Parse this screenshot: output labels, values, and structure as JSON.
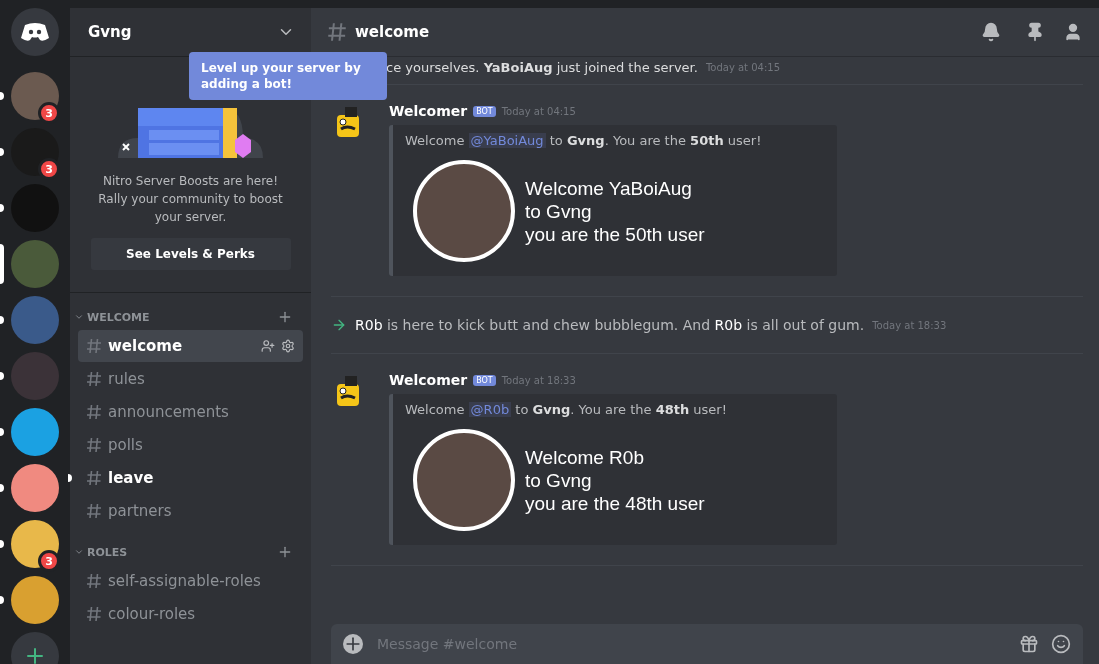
{
  "servers": [
    {
      "kind": "home",
      "selected": false,
      "unread": false
    },
    {
      "kind": "server",
      "selected": false,
      "unread": true,
      "badge": "3"
    },
    {
      "kind": "server",
      "selected": false,
      "unread": true,
      "badge": "3"
    },
    {
      "kind": "server",
      "selected": false,
      "unread": true
    },
    {
      "kind": "server",
      "selected": true
    },
    {
      "kind": "server",
      "selected": false,
      "unread": true
    },
    {
      "kind": "server",
      "selected": false,
      "unread": true
    },
    {
      "kind": "server",
      "selected": false,
      "unread": true
    },
    {
      "kind": "server",
      "selected": false,
      "unread": true
    },
    {
      "kind": "server",
      "selected": false,
      "unread": true,
      "badge": "3"
    },
    {
      "kind": "server",
      "selected": false,
      "unread": true
    },
    {
      "kind": "add",
      "selected": false,
      "unread": false
    }
  ],
  "guild": {
    "name": "Gvng",
    "tooltip": "Level up your server by adding a bot!",
    "boost_text": "Nitro Server Boosts are here! Rally your community to boost your server.",
    "boost_button": "See Levels & Perks"
  },
  "categories": [
    {
      "name": "WELCOME",
      "expanded": true,
      "channels": [
        {
          "name": "welcome",
          "selected": true,
          "unread": false
        },
        {
          "name": "rules",
          "selected": false,
          "unread": false
        },
        {
          "name": "announcements",
          "selected": false,
          "unread": false
        },
        {
          "name": "polls",
          "selected": false,
          "unread": false
        },
        {
          "name": "leave",
          "selected": false,
          "unread": true
        },
        {
          "name": "partners",
          "selected": false,
          "unread": false
        }
      ]
    },
    {
      "name": "ROLES",
      "expanded": true,
      "channels": [
        {
          "name": "self-assignable-roles",
          "selected": false,
          "unread": false
        },
        {
          "name": "colour-roles",
          "selected": false,
          "unread": false
        }
      ]
    }
  ],
  "header": {
    "channel": "welcome"
  },
  "messages": [
    {
      "kind": "partial",
      "text": "ce yourselves. **YaBoiAug** just joined the server.",
      "time": "Today at 04:15"
    },
    {
      "kind": "bot",
      "author": "Welcomer",
      "tag": "BOT",
      "time": "Today at 04:15",
      "embed_parts": [
        "Welcome ",
        "@YaBoiAug",
        " to **Gvng**. You are the **50th** user!"
      ],
      "card_lines": [
        "Welcome YaBoiAug",
        "to Gvng",
        "you are the 50th user"
      ]
    },
    {
      "kind": "join",
      "text": "**R0b** is here to kick butt and chew bubblegum. And **R0b** is all out of gum.",
      "time": "Today at 18:33"
    },
    {
      "kind": "bot",
      "author": "Welcomer",
      "tag": "BOT",
      "time": "Today at 18:33",
      "embed_parts": [
        "Welcome ",
        "@R0b",
        " to **Gvng**. You are the **48th** user!"
      ],
      "card_lines": [
        "Welcome R0b",
        "to Gvng",
        "you are the 48th user"
      ]
    }
  ],
  "composer": {
    "placeholder": "Message #welcome"
  }
}
